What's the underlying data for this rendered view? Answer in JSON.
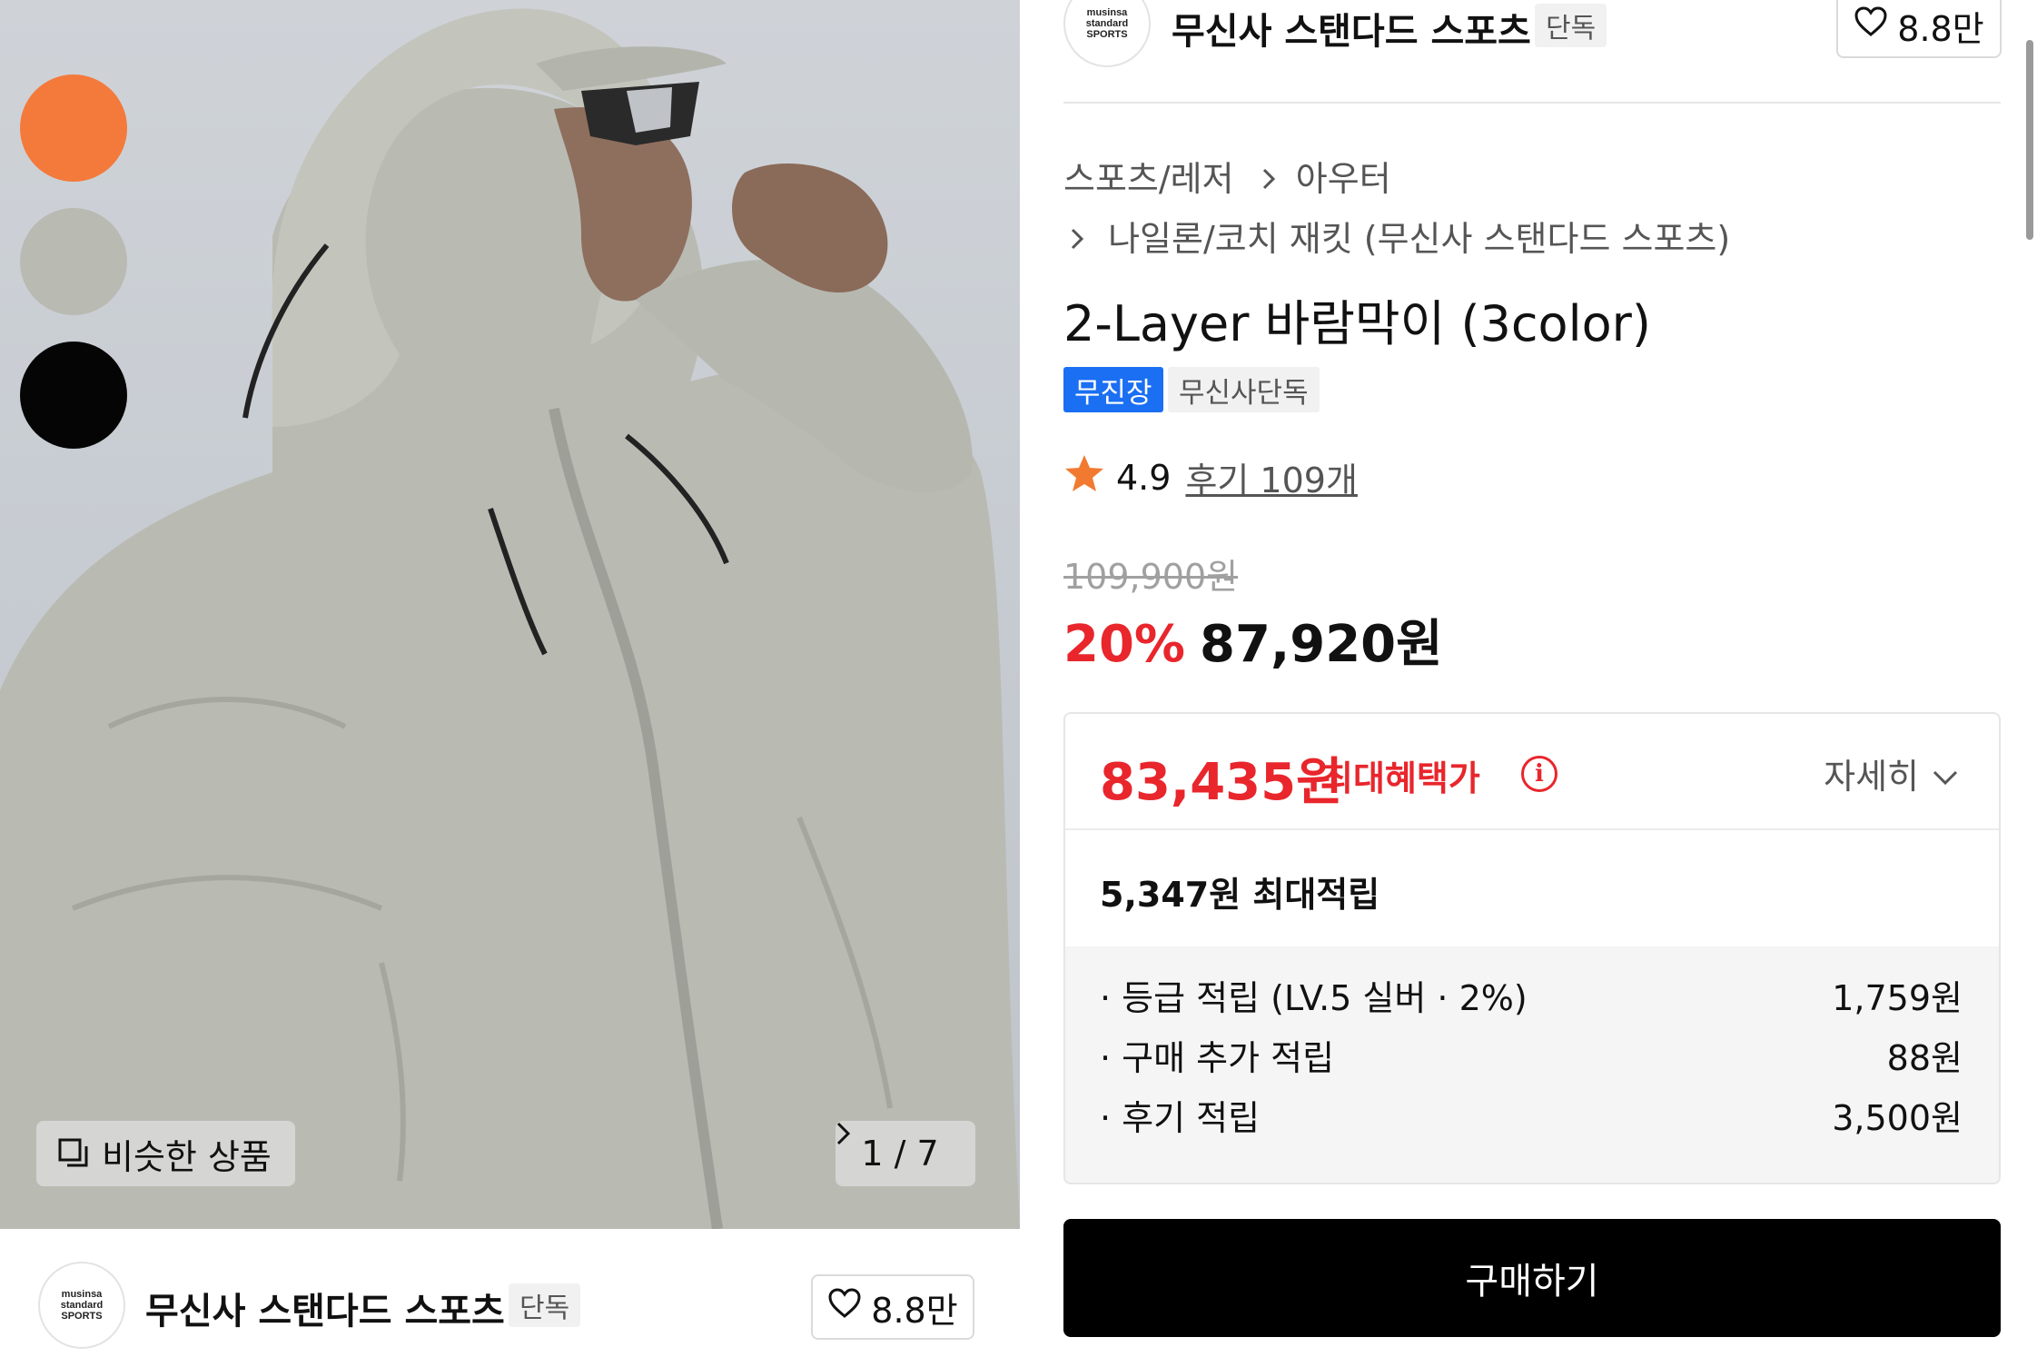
{
  "image": {
    "alt": "Model wearing a light grey hooded 2-layer windbreaker",
    "pager": "1 / 7",
    "similar_label": "비슷한 상품",
    "swatches": [
      {
        "name": "orange",
        "color": "#f47a3c"
      },
      {
        "name": "grey",
        "color": "#b9bab2"
      },
      {
        "name": "black",
        "color": "#050505"
      }
    ]
  },
  "brand": {
    "logo_lines": [
      "musinsa",
      "standard",
      "SPORTS"
    ],
    "name": "무신사 스탠다드 스포츠",
    "exclusive_tag": "단독",
    "likes": "8.8만"
  },
  "breadcrumb": {
    "level1": "스포츠/레저",
    "level2": "아우터",
    "level3": "나일론/코치 재킷 (무신사 스탠다드 스포츠)"
  },
  "product": {
    "title": "2-Layer 바람막이 (3color)",
    "badges": [
      "무진장",
      "무신사단독"
    ],
    "rating": "4.9",
    "reviews": "후기 109개",
    "original_price": "109,900원",
    "discount": "20%",
    "price": "87,920원"
  },
  "benefit": {
    "max_price": "83,435원",
    "max_label": "최대혜택가",
    "info_icon": "i",
    "detail_label": "자세히",
    "points_total": "5,347원 최대적립",
    "items": [
      {
        "label": "· 등급 적립 (LV.5 실버 · 2%)",
        "value": "1,759원"
      },
      {
        "label": "· 구매 추가 적립",
        "value": "88원"
      },
      {
        "label": "· 후기 적립",
        "value": "3,500원"
      }
    ]
  },
  "buy_label": "구매하기",
  "colors": {
    "accent_red": "#e8262c",
    "badge_blue": "#1b6ff3",
    "buy_button": "#000000"
  }
}
